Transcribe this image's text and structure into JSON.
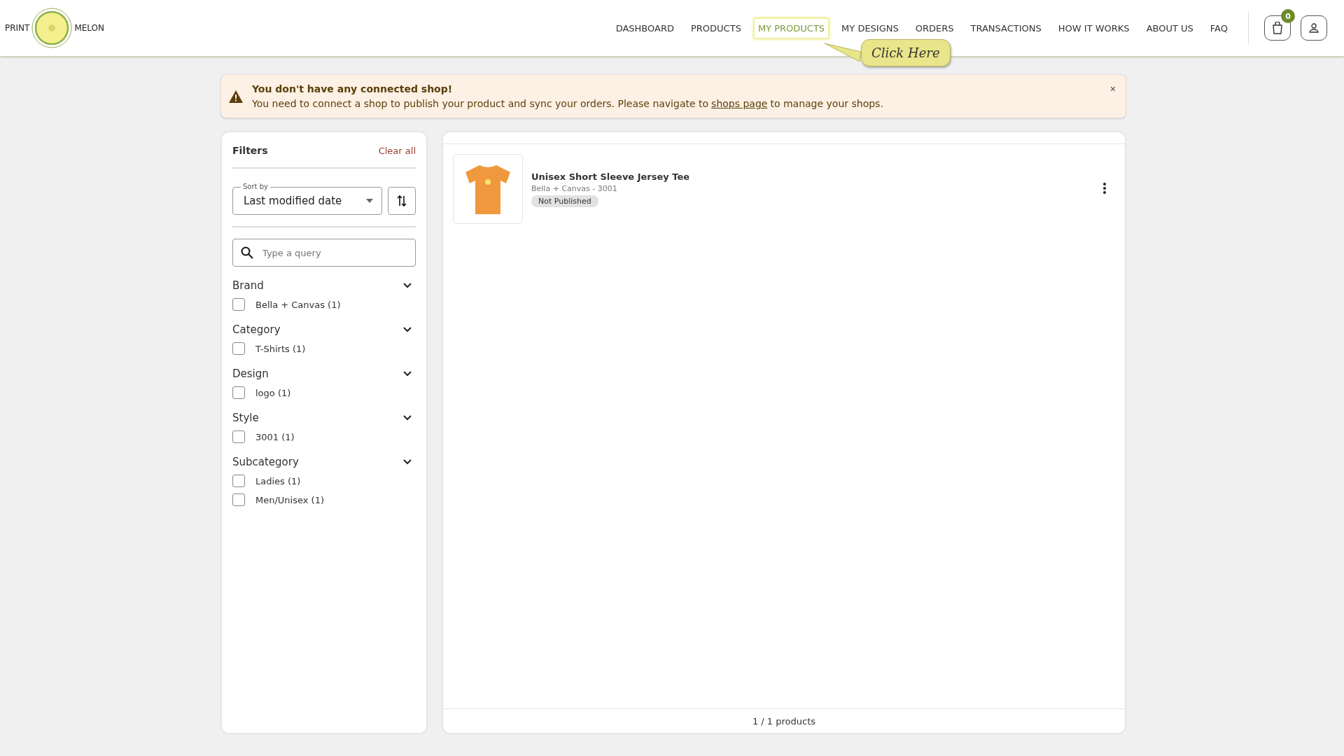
{
  "logo": {
    "left": "PRINT",
    "right": "MELON"
  },
  "nav": [
    {
      "label": "DASHBOARD",
      "selected": false
    },
    {
      "label": "PRODUCTS",
      "selected": false
    },
    {
      "label": "MY PRODUCTS",
      "selected": true
    },
    {
      "label": "MY DESIGNS",
      "selected": false
    },
    {
      "label": "ORDERS",
      "selected": false
    },
    {
      "label": "TRANSACTIONS",
      "selected": false
    },
    {
      "label": "HOW IT WORKS",
      "selected": false
    },
    {
      "label": "ABOUT US",
      "selected": false
    },
    {
      "label": "FAQ",
      "selected": false
    }
  ],
  "cart_count": "0",
  "tooltip": "Click Here",
  "alert": {
    "title": "You don't have any connected shop!",
    "text_before": "You need to connect a shop to publish your product and sync your orders. Please navigate to",
    "link": "shops page",
    "text_after": "to manage your shops.",
    "close": "×"
  },
  "filters": {
    "title": "Filters",
    "clear": "Clear all",
    "sort_label": "Sort by",
    "sort_value": "Last modified date",
    "search_placeholder": "Type a query",
    "groups": [
      {
        "title": "Brand",
        "expanded": true,
        "options": [
          {
            "label": "Bella + Canvas (1)",
            "checked": false
          }
        ]
      },
      {
        "title": "Category",
        "expanded": true,
        "options": [
          {
            "label": "T-Shirts (1)",
            "checked": false
          }
        ]
      },
      {
        "title": "Design",
        "expanded": true,
        "options": [
          {
            "label": "logo (1)",
            "checked": false
          }
        ]
      },
      {
        "title": "Style",
        "expanded": true,
        "options": [
          {
            "label": "3001 (1)",
            "checked": false
          }
        ]
      },
      {
        "title": "Subcategory",
        "expanded": true,
        "options": [
          {
            "label": "Ladies (1)",
            "checked": false
          },
          {
            "label": "Men/Unisex (1)",
            "checked": false
          }
        ]
      }
    ]
  },
  "products": [
    {
      "name": "Unisex Short Sleeve Jersey Tee",
      "subtitle": "Bella + Canvas - 3001",
      "status": "Not Published"
    }
  ],
  "count": "1 / 1 products"
}
